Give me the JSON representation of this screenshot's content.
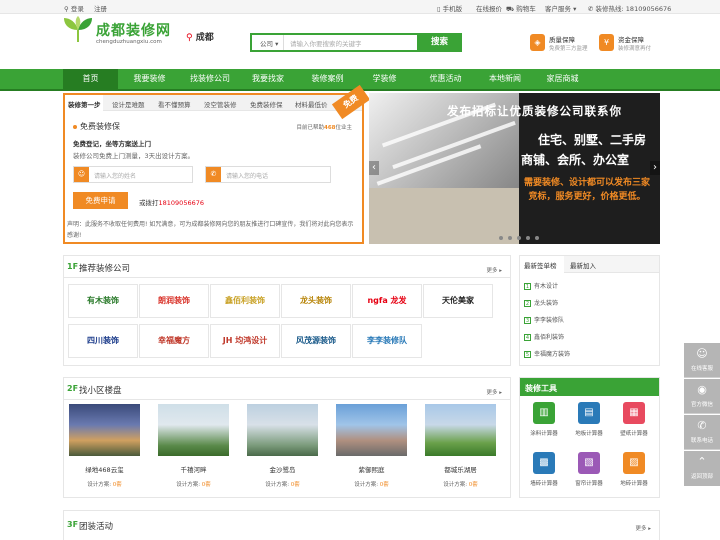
{
  "topbar": {
    "login": "登录",
    "register": "注册",
    "mobile": "手机版",
    "quote": "在线报价",
    "cart": "购物车",
    "service": "客户服务",
    "hotline_label": "装修热线:",
    "hotline": "18109056676"
  },
  "header": {
    "logo_title": "成都装修网",
    "logo_sub": "chengduzhuangxiu.com",
    "city": "成都",
    "search_category": "公司",
    "search_placeholder": "请输入你要搜索的关键字",
    "search_button": "搜索",
    "promise1_title": "质量保障",
    "promise1_sub": "免费第三方监理",
    "promise2_title": "资金保障",
    "promise2_sub": "装修满意再付"
  },
  "nav": [
    "首页",
    "我要装修",
    "找装修公司",
    "我要找家",
    "装修案例",
    "学装修",
    "优惠活动",
    "本地新闻",
    "家居商城"
  ],
  "form": {
    "tabs": [
      "装修第一步",
      "设计是难题",
      "看不懂预算",
      "没空管装修",
      "免费装修保",
      "材料最低价"
    ],
    "ribbon": "免费",
    "title": "免费装修保",
    "applied_pre": "目前已帮助",
    "applied_count": "468",
    "applied_post": "位业主",
    "slogan1": "免费登记，坐等方案送上门",
    "slogan2": "装修公司免费上门测量，3天出设计方案。",
    "name_placeholder": "请输入您的姓名",
    "phone_placeholder": "请输入您的电话",
    "apply_button": "免费申请",
    "call_pre": "或拨打",
    "call_number": "18109056676",
    "notice": "声明：此服务不收取任何费用! 如咒满意，可为成都装修网向您的朋友推进行口碑宣传，我们将对此向您表示感谢!"
  },
  "banner": {
    "title": "发布招标让优质装修公司联系你",
    "line1": "住宅、别墅、二手房",
    "line2": "商铺、会所、办公室",
    "line3": "需要装修、设计都可以发布三家竞标，服务更好，价格更低。"
  },
  "companies": {
    "num": "1F",
    "title": "推荐装修公司",
    "more": "更多",
    "logos": [
      {
        "name": "有木装饰",
        "color": "#2a7a2a"
      },
      {
        "name": "朗润装饰",
        "color": "#d9342b"
      },
      {
        "name": "鑫佰利装饰",
        "color": "#c9a227"
      },
      {
        "name": "龙头装饰",
        "color": "#b8860b"
      },
      {
        "name": "ngfa 龙发",
        "color": "#e60012"
      },
      {
        "name": "天伦美家",
        "color": "#222222"
      },
      {
        "name": "四川装饰",
        "color": "#1a3a8a"
      },
      {
        "name": "幸福魔方",
        "color": "#c0392b"
      },
      {
        "name": "JH 均鸿设计",
        "color": "#c0392b"
      },
      {
        "name": "风茂源装饰",
        "color": "#1a5a8a"
      },
      {
        "name": "李李装修队",
        "color": "#2a7ab8"
      }
    ]
  },
  "ranking": {
    "tab1": "最新签单榜",
    "tab2": "最新加入",
    "items": [
      "有木设计",
      "龙头装饰",
      "李李装修队",
      "鑫佰利装饰",
      "幸福魔方装饰"
    ]
  },
  "estates": {
    "num": "2F",
    "title": "找小区楼盘",
    "more": "更多",
    "cases_label": "设计方案:",
    "items": [
      {
        "name": "绿地468云玺",
        "cases": "0套"
      },
      {
        "name": "千禧河畔",
        "cases": "0套"
      },
      {
        "name": "金沙鹭岛",
        "cases": "0套"
      },
      {
        "name": "紫御熙庭",
        "cases": "0套"
      },
      {
        "name": "都城乐湖居",
        "cases": "0套"
      }
    ]
  },
  "tools": {
    "title": "装修工具",
    "items": [
      {
        "name": "涂料计算器",
        "color": "#3aa336"
      },
      {
        "name": "地板计算器",
        "color": "#2a7ab8"
      },
      {
        "name": "壁纸计算器",
        "color": "#e84a5f"
      },
      {
        "name": "墙砖计算器",
        "color": "#2a7ab8"
      },
      {
        "name": "窗帘计算器",
        "color": "#9b59b6"
      },
      {
        "name": "地砖计算器",
        "color": "#f08a24"
      }
    ]
  },
  "groupbuy": {
    "num": "3F",
    "title": "团装活动",
    "more": "更多"
  },
  "float": [
    "在线客服",
    "官方微信",
    "联系电话",
    "返回顶部"
  ]
}
